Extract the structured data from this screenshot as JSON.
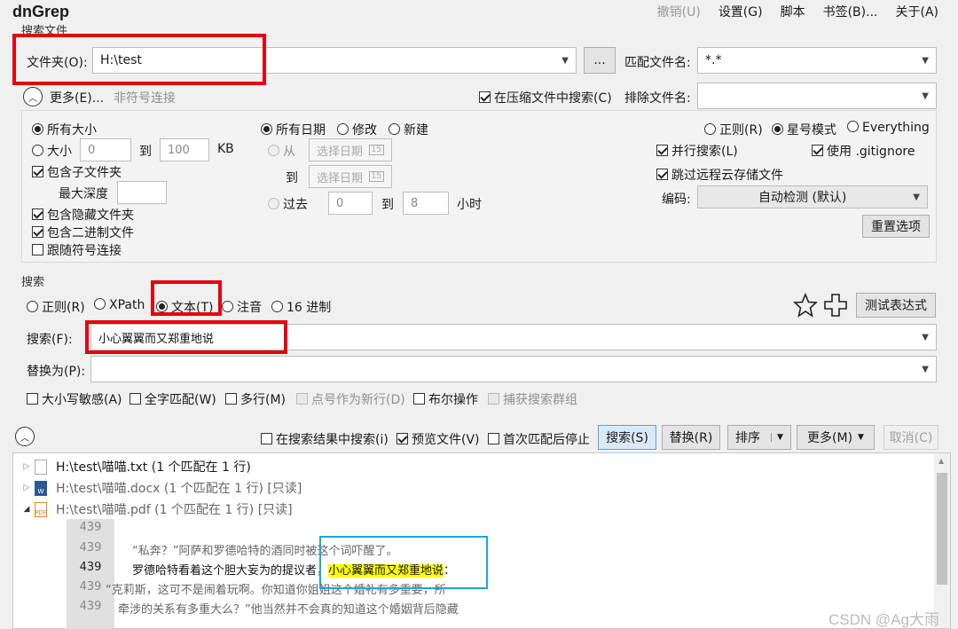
{
  "app": {
    "title": "dnGrep"
  },
  "menu": [
    {
      "label": "撤销(U)",
      "disabled": true
    },
    {
      "label": "设置(G)",
      "disabled": false
    },
    {
      "label": "脚本",
      "disabled": false
    },
    {
      "label": "书签(B)...",
      "disabled": false
    },
    {
      "label": "关于(A)",
      "disabled": false
    }
  ],
  "search_files": {
    "group_label": "搜索文件",
    "folder_label": "文件夹(O):",
    "folder_value": "H:\\test",
    "browse_label": "...",
    "match_file_label": "匹配文件名:",
    "match_file_value": "*.*",
    "more_label": "更多(E)...",
    "no_symlink_label": "非符号连接",
    "search_archives_label": "在压缩文件中搜索(C)",
    "exclude_file_label": "排除文件名:",
    "exclude_file_value": ""
  },
  "options": {
    "all_sizes": "所有大小",
    "size": "大小",
    "size_from": "0",
    "size_to_label": "到",
    "size_to": "100",
    "size_unit": "KB",
    "include_subfolders": "包含子文件夹",
    "max_depth": "最大深度",
    "include_hidden": "包含隐藏文件夹",
    "include_binary": "包含二进制文件",
    "follow_symlinks": "跟随符号连接",
    "all_dates": "所有日期",
    "modified": "修改",
    "created": "新建",
    "from": "从",
    "date_placeholder_1": "选择日期",
    "to": "到",
    "date_placeholder_2": "选择日期",
    "past": "过去",
    "past_from": "0",
    "past_to_label": "到",
    "past_to": "8",
    "hours": "小时",
    "regex": "正则(R)",
    "wildcard": "星号模式",
    "everything": "Everything",
    "parallel": "并行搜索(L)",
    "use_gitignore": "使用 .gitignore",
    "skip_cloud": "跳过远程云存储文件",
    "encoding_label": "编码:",
    "encoding_value": "自动检测 (默认)",
    "reset_label": "重置选项"
  },
  "search": {
    "group_label": "搜索",
    "types": [
      "正则(R)",
      "XPath",
      "文本(T)",
      "注音",
      "16 进制"
    ],
    "test_regex_label": "测试表达式",
    "search_label": "搜索(F):",
    "search_value": "小心翼翼而又郑重地说",
    "replace_label": "替换为(P):",
    "replace_value": "",
    "case_sensitive": "大小写敏感(A)",
    "whole_word": "全字匹配(W)",
    "multiline": "多行(M)",
    "dot_newline": "点号作为新行(D)",
    "boolean": "布尔操作",
    "capture_groups": "捕获搜索群组"
  },
  "toolbar": {
    "search_in_results": "在搜索结果中搜索(i)",
    "preview_file": "预览文件(V)",
    "stop_after_first": "首次匹配后停止",
    "search_btn": "搜索(S)",
    "replace_btn": "替换(R)",
    "sort_btn": "排序",
    "more_btn": "更多(M)",
    "cancel_btn": "取消(C)"
  },
  "results": {
    "files": [
      {
        "path": "H:\\test\\喵喵.txt (1 个匹配在 1 行)",
        "icon": "text-file-icon",
        "expanded": false,
        "dim": false
      },
      {
        "path": "H:\\test\\喵喵.docx (1 个匹配在 1 行) [只读]",
        "icon": "word-file-icon",
        "expanded": false,
        "dim": true
      },
      {
        "path": "H:\\test\\喵喵.pdf (1 个匹配在 1 行) [只读]",
        "icon": "pdf-file-icon",
        "expanded": true,
        "dim": true
      }
    ],
    "lines": [
      {
        "num": "439",
        "text": ""
      },
      {
        "num": "439",
        "text": "“私奔？”阿萨和罗德哈特的酒同时被这个词吓醒了。"
      },
      {
        "num": "439",
        "pre": "罗德哈特看着这个胆大妄为的提议者，",
        "match": "小心翼翼而又郑重地说",
        "post": "："
      },
      {
        "num": "439",
        "text": "“克莉斯，这可不是闹着玩啊。你知道你姐姐这个婚礼有多重要，所"
      },
      {
        "num": "439",
        "text": "牵涉的关系有多重大么？”他当然并不会真的知道这个婚姻背后隐藏"
      }
    ]
  },
  "watermark": "CSDN @Ag大雨",
  "colors": {
    "annotation_red": "#e60012",
    "annotation_blue": "#1aa7e0",
    "match_highlight": "#ffff00"
  }
}
